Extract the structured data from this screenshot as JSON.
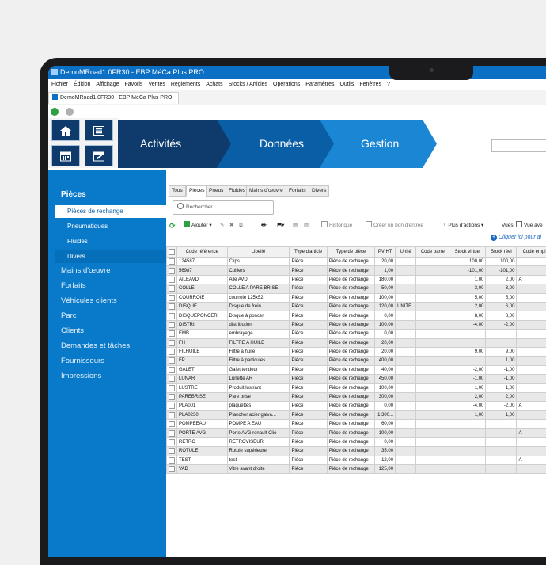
{
  "window": {
    "title": "DemoMRoad1.0FR30 - EBP MéCa Plus PRO",
    "doc_tab": "DemoMRoad1.0FR30 - EBP MéCa Plus PRO"
  },
  "menu": [
    "Fichier",
    "Édition",
    "Affichage",
    "Favoris",
    "Ventes",
    "Règlements",
    "Achats",
    "Stocks / Articles",
    "Opérations",
    "Paramètres",
    "Outils",
    "Fenêtres",
    "?"
  ],
  "nav": {
    "activites": "Activités",
    "donnees": "Données",
    "gestion": "Gestion"
  },
  "sidebar": {
    "title": "Pièces",
    "subitems": [
      "Pièces de rechange",
      "Pneumatiques",
      "Fluides",
      "Divers"
    ],
    "items": [
      "Mains d'œuvre",
      "Forfaits",
      "Véhicules clients",
      "Parc",
      "Clients",
      "Demandes et tâches",
      "Fournisseurs",
      "Impressions"
    ]
  },
  "tabs": [
    "Tous",
    "Pièces",
    "Pneus",
    "Fluides",
    "Mains d'œuvre",
    "Forfaits",
    "Divers"
  ],
  "search_placeholder": "Rechercher",
  "toolbar": {
    "ajouter": "Ajouter",
    "historique": "Historique",
    "creer": "Créer un bon d'entrée",
    "plus_actions": "Plus d'actions",
    "vues": "Vues",
    "vue": "Vue ave"
  },
  "clique": "Cliquer ici pour aj",
  "table": {
    "headers": [
      "Code référence",
      "Libellé",
      "Type d'article",
      "Type de pièce",
      "PV HT",
      "Unité",
      "Code barre",
      "Stock virtuel",
      "Stock réel",
      "Code empla"
    ],
    "rows": [
      [
        "124587",
        "Clips",
        "Pièce",
        "Pièce de rechange",
        "20,00",
        "",
        "",
        "100,00",
        "100,00",
        ""
      ],
      [
        "56987",
        "Colliers",
        "Pièce",
        "Pièce de rechange",
        "1,00",
        "",
        "",
        "-101,00",
        "-101,00",
        ""
      ],
      [
        "AILEAVD",
        "Aile AVD",
        "Pièce",
        "Pièce de rechange",
        "180,00",
        "",
        "",
        "1,00",
        "2,00",
        "A"
      ],
      [
        "COLLE",
        "COLLE A PARE BRISE",
        "Pièce",
        "Pièce de rechange",
        "50,00",
        "",
        "",
        "3,00",
        "3,00",
        ""
      ],
      [
        "COURROIE",
        "courroie 125x52",
        "Pièce",
        "Pièce de rechange",
        "100,00",
        "",
        "",
        "5,00",
        "5,00",
        ""
      ],
      [
        "DISQUE",
        "Disque de frein",
        "Pièce",
        "Pièce de rechange",
        "120,00",
        "UNITE",
        "",
        "2,00",
        "6,00",
        ""
      ],
      [
        "DISQUEPONCER",
        "Disque à poncer",
        "Pièce",
        "Pièce de rechange",
        "0,00",
        "",
        "",
        "8,00",
        "8,00",
        ""
      ],
      [
        "DISTRI",
        "distribution",
        "Pièce",
        "Pièce de rechange",
        "100,00",
        "",
        "",
        "-4,00",
        "-2,00",
        ""
      ],
      [
        "EMB",
        "embrayage",
        "Pièce",
        "Pièce de rechange",
        "0,00",
        "",
        "",
        "",
        "",
        ""
      ],
      [
        "FH",
        "FILTRE A HUILE",
        "Pièce",
        "Pièce de rechange",
        "20,00",
        "",
        "",
        "",
        "",
        ""
      ],
      [
        "FILHUILE",
        "Filtre à huile",
        "Pièce",
        "Pièce de rechange",
        "20,00",
        "",
        "",
        "9,00",
        "9,00",
        ""
      ],
      [
        "FP",
        "Filtre à particules",
        "Pièce",
        "Pièce de rechange",
        "400,00",
        "",
        "",
        "",
        "1,00",
        ""
      ],
      [
        "GALET",
        "Galet tendeur",
        "Pièce",
        "Pièce de rechange",
        "40,00",
        "",
        "",
        "-2,00",
        "-1,00",
        ""
      ],
      [
        "LUNAR",
        "Lunette AR",
        "Pièce",
        "Pièce de rechange",
        "450,00",
        "",
        "",
        "-1,00",
        "-1,00",
        ""
      ],
      [
        "LUSTRE",
        "Produit lustrant",
        "Pièce",
        "Pièce de rechange",
        "100,00",
        "",
        "",
        "1,00",
        "1,00",
        ""
      ],
      [
        "PAREBRISE",
        "Pare brise",
        "Pièce",
        "Pièce de rechange",
        "300,00",
        "",
        "",
        "2,00",
        "2,00",
        ""
      ],
      [
        "PLA001",
        "plaquettes",
        "Pièce",
        "Pièce de rechange",
        "0,00",
        "",
        "",
        "-4,00",
        "-2,00",
        "A"
      ],
      [
        "PLA0230",
        "Plancher acier galva...",
        "Pièce",
        "Pièce de rechange",
        "1 300...",
        "",
        "",
        "1,00",
        "1,00",
        ""
      ],
      [
        "POMPEEAU",
        "POMPE A EAU",
        "Pièce",
        "Pièce de rechange",
        "60,00",
        "",
        "",
        "",
        "",
        ""
      ],
      [
        "PORTE AVG",
        "Porte AVG renault Clio",
        "Pièce",
        "Pièce de rechange",
        "100,00",
        "",
        "",
        "",
        "",
        "A"
      ],
      [
        "RETRO",
        "RETROVISEUR",
        "Pièce",
        "Pièce de rechange",
        "0,00",
        "",
        "",
        "",
        "",
        ""
      ],
      [
        "ROTULE",
        "Rotule supérieure",
        "Pièce",
        "Pièce de rechange",
        "35,00",
        "",
        "",
        "",
        "",
        ""
      ],
      [
        "TEST",
        "test",
        "Pièce",
        "Pièce de rechange",
        "12,00",
        "",
        "",
        "",
        "",
        "A"
      ],
      [
        "VAD",
        "Vitre avant droite",
        "Pièce",
        "Pièce de rechange",
        "125,00",
        "",
        "",
        "",
        "",
        ""
      ]
    ]
  },
  "colors": {
    "accent": "#0979c9",
    "arrow1": "#0e3b6b",
    "arrow2": "#0a5ea6",
    "arrow3": "#1a86d4",
    "titlebar": "#0b6fc4"
  }
}
